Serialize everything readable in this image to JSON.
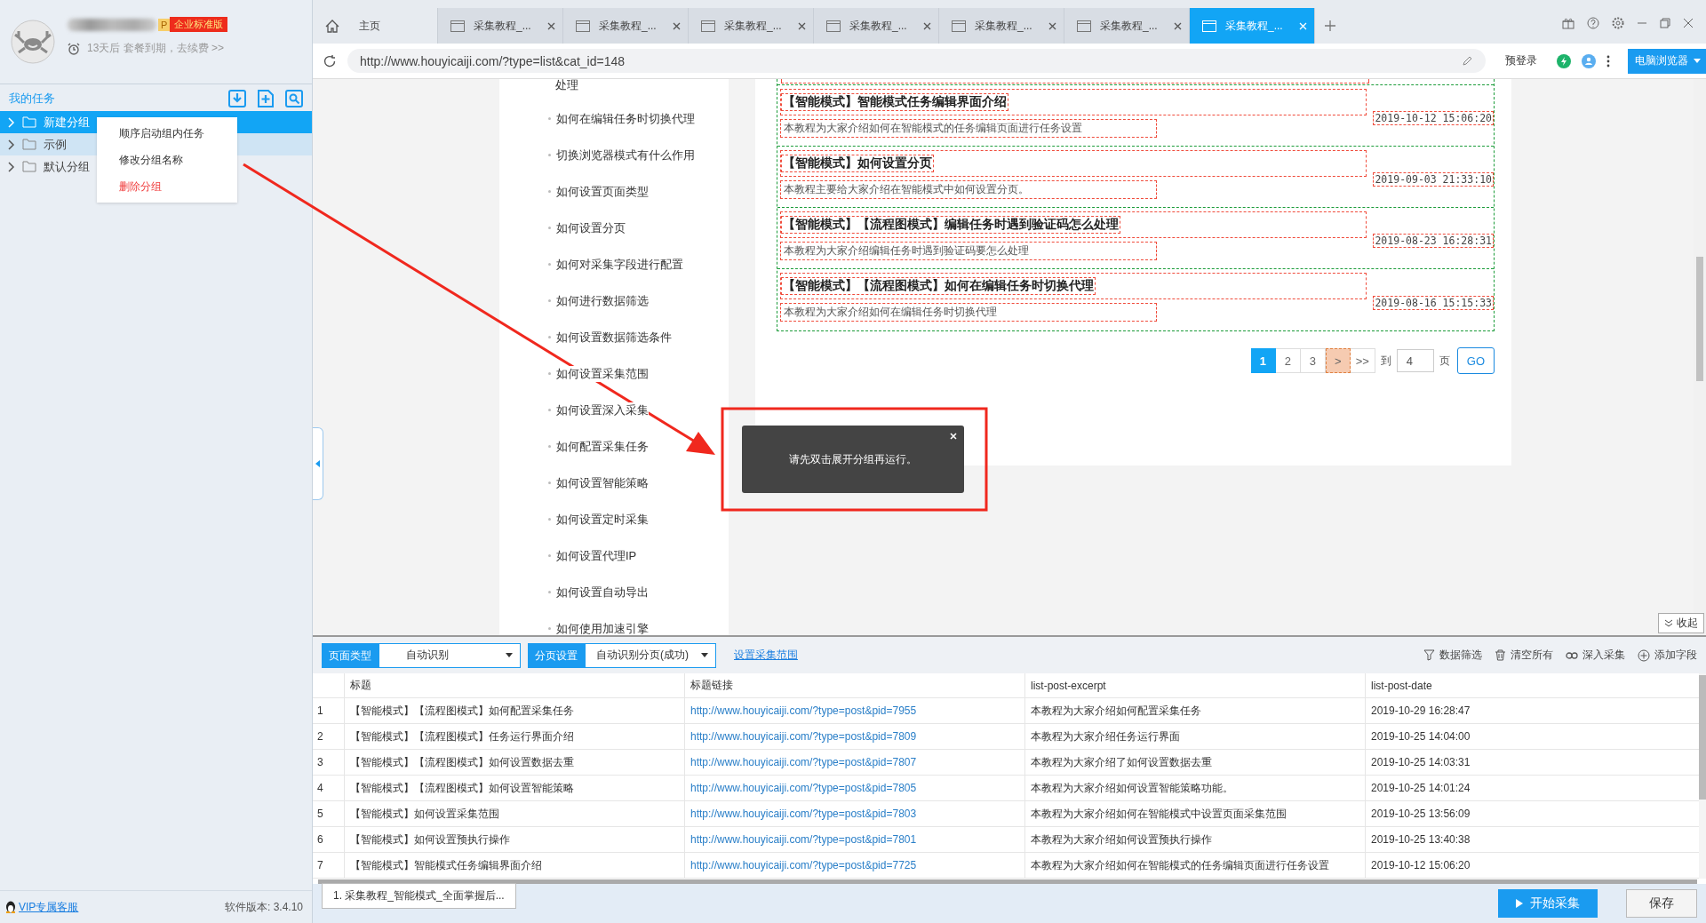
{
  "profile": {
    "p_badge": "P",
    "edition_badge": "企业标准版",
    "expiry": "13天后 套餐到期，去续费 >>"
  },
  "sidebar": {
    "title": "我的任务",
    "groups": [
      {
        "label": "新建分组",
        "selected": true,
        "hovered": false
      },
      {
        "label": "示例",
        "selected": false,
        "hovered": true
      },
      {
        "label": "默认分组",
        "selected": false,
        "hovered": false
      }
    ],
    "context_menu": [
      {
        "label": "顺序启动组内任务",
        "kind": "normal"
      },
      {
        "label": "修改分组名称",
        "kind": "normal"
      },
      {
        "label": "删除分组",
        "kind": "danger"
      }
    ],
    "support_link": "VIP专属客服",
    "version": "软件版本: 3.4.10"
  },
  "tabs": [
    {
      "label": "主页",
      "kind": "home",
      "selected": false
    },
    {
      "label": "采集教程_...",
      "kind": "page",
      "selected": false
    },
    {
      "label": "采集教程_...",
      "kind": "page",
      "selected": false
    },
    {
      "label": "采集教程_...",
      "kind": "page",
      "selected": false
    },
    {
      "label": "采集教程_...",
      "kind": "page",
      "selected": false
    },
    {
      "label": "采集教程_...",
      "kind": "page",
      "selected": false
    },
    {
      "label": "采集教程_...",
      "kind": "page",
      "selected": false
    },
    {
      "label": "采集教程_...",
      "kind": "page",
      "selected": true
    }
  ],
  "address": {
    "url": "http://www.houyicaiji.com/?type=list&cat_id=148",
    "prelogin": "预登录",
    "browser_mode": "电脑浏览器"
  },
  "web": {
    "nav_cut": "处理",
    "nav_items": [
      "如何在编辑任务时切换代理",
      "切换浏览器模式有什么作用",
      "如何设置页面类型",
      "如何设置分页",
      "如何对采集字段进行配置",
      "如何进行数据筛选",
      "如何设置数据筛选条件",
      "如何设置采集范围",
      "如何设置深入采集",
      "如何配置采集任务",
      "如何设置智能策略",
      "如何设置定时采集",
      "如何设置代理IP",
      "如何设置自动导出",
      "如何使用加速引擎"
    ],
    "articles": [
      {
        "title": "【智能模式】智能模式任务编辑界面介绍",
        "excerpt": "本教程为大家介绍如何在智能模式的任务编辑页面进行任务设置",
        "date": "2019-10-12 15:06:20"
      },
      {
        "title": "【智能模式】如何设置分页",
        "excerpt": "本教程主要给大家介绍在智能模式中如何设置分页。",
        "date": "2019-09-03 21:33:10"
      },
      {
        "title": "【智能模式】【流程图模式】编辑任务时遇到验证码怎么处理",
        "excerpt": "本教程为大家介绍编辑任务时遇到验证码要怎么处理",
        "date": "2019-08-23 16:28:31"
      },
      {
        "title": "【智能模式】【流程图模式】如何在编辑任务时切换代理",
        "excerpt": "本教程为大家介绍如何在编辑任务时切换代理",
        "date": "2019-08-16 15:15:33"
      }
    ],
    "pages": [
      {
        "label": "1",
        "selected": true
      },
      {
        "label": "2",
        "selected": false
      },
      {
        "label": "3",
        "selected": false
      }
    ],
    "next": ">",
    "last": ">>",
    "goto_label": "到",
    "goto_value": "4",
    "page_unit": "页",
    "go": "GO",
    "collapse": "收起"
  },
  "toast": {
    "message": "请先双击展开分组再运行。"
  },
  "panel": {
    "page_type_label": "页面类型",
    "page_type_value": "自动识别",
    "paging_label": "分页设置",
    "paging_value": "自动识别分页(成功)",
    "range_link": "设置采集范围",
    "tools": [
      {
        "label": "数据筛选",
        "kind": "filter"
      },
      {
        "label": "清空所有",
        "kind": "trash"
      },
      {
        "label": "深入采集",
        "kind": "link"
      },
      {
        "label": "添加字段",
        "kind": "add"
      }
    ],
    "columns": [
      "标题",
      "标题链接",
      "list-post-excerpt",
      "list-post-date"
    ],
    "rows": [
      {
        "index": "1",
        "cells": [
          "【智能模式】【流程图模式】如何配置采集任务",
          "http://www.houyicaiji.com/?type=post&pid=7955",
          "本教程为大家介绍如何配置采集任务",
          "2019-10-29 16:28:47"
        ]
      },
      {
        "index": "2",
        "cells": [
          "【智能模式】【流程图模式】任务运行界面介绍",
          "http://www.houyicaiji.com/?type=post&pid=7809",
          "本教程为大家介绍任务运行界面",
          "2019-10-25 14:04:00"
        ]
      },
      {
        "index": "3",
        "cells": [
          "【智能模式】【流程图模式】如何设置数据去重",
          "http://www.houyicaiji.com/?type=post&pid=7807",
          "本教程为大家介绍了如何设置数据去重",
          "2019-10-25 14:03:31"
        ]
      },
      {
        "index": "4",
        "cells": [
          "【智能模式】【流程图模式】如何设置智能策略",
          "http://www.houyicaiji.com/?type=post&pid=7805",
          "本教程为大家介绍如何设置智能策略功能。",
          "2019-10-25 14:01:24"
        ]
      },
      {
        "index": "5",
        "cells": [
          "【智能模式】如何设置采集范围",
          "http://www.houyicaiji.com/?type=post&pid=7803",
          "本教程为大家介绍如何在智能模式中设置页面采集范围",
          "2019-10-25 13:56:09"
        ]
      },
      {
        "index": "6",
        "cells": [
          "【智能模式】如何设置预执行操作",
          "http://www.houyicaiji.com/?type=post&pid=7801",
          "本教程为大家介绍如何设置预执行操作",
          "2019-10-25 13:40:38"
        ]
      },
      {
        "index": "7",
        "cells": [
          "【智能模式】智能模式任务编辑界面介绍",
          "http://www.houyicaiji.com/?type=post&pid=7725",
          "本教程为大家介绍如何在智能模式的任务编辑页面进行任务设置",
          "2019-10-12 15:06:20"
        ]
      }
    ]
  },
  "footer": {
    "task_tab": "1. 采集教程_智能模式_全面掌握后...",
    "start": "开始采集",
    "save": "保存"
  }
}
